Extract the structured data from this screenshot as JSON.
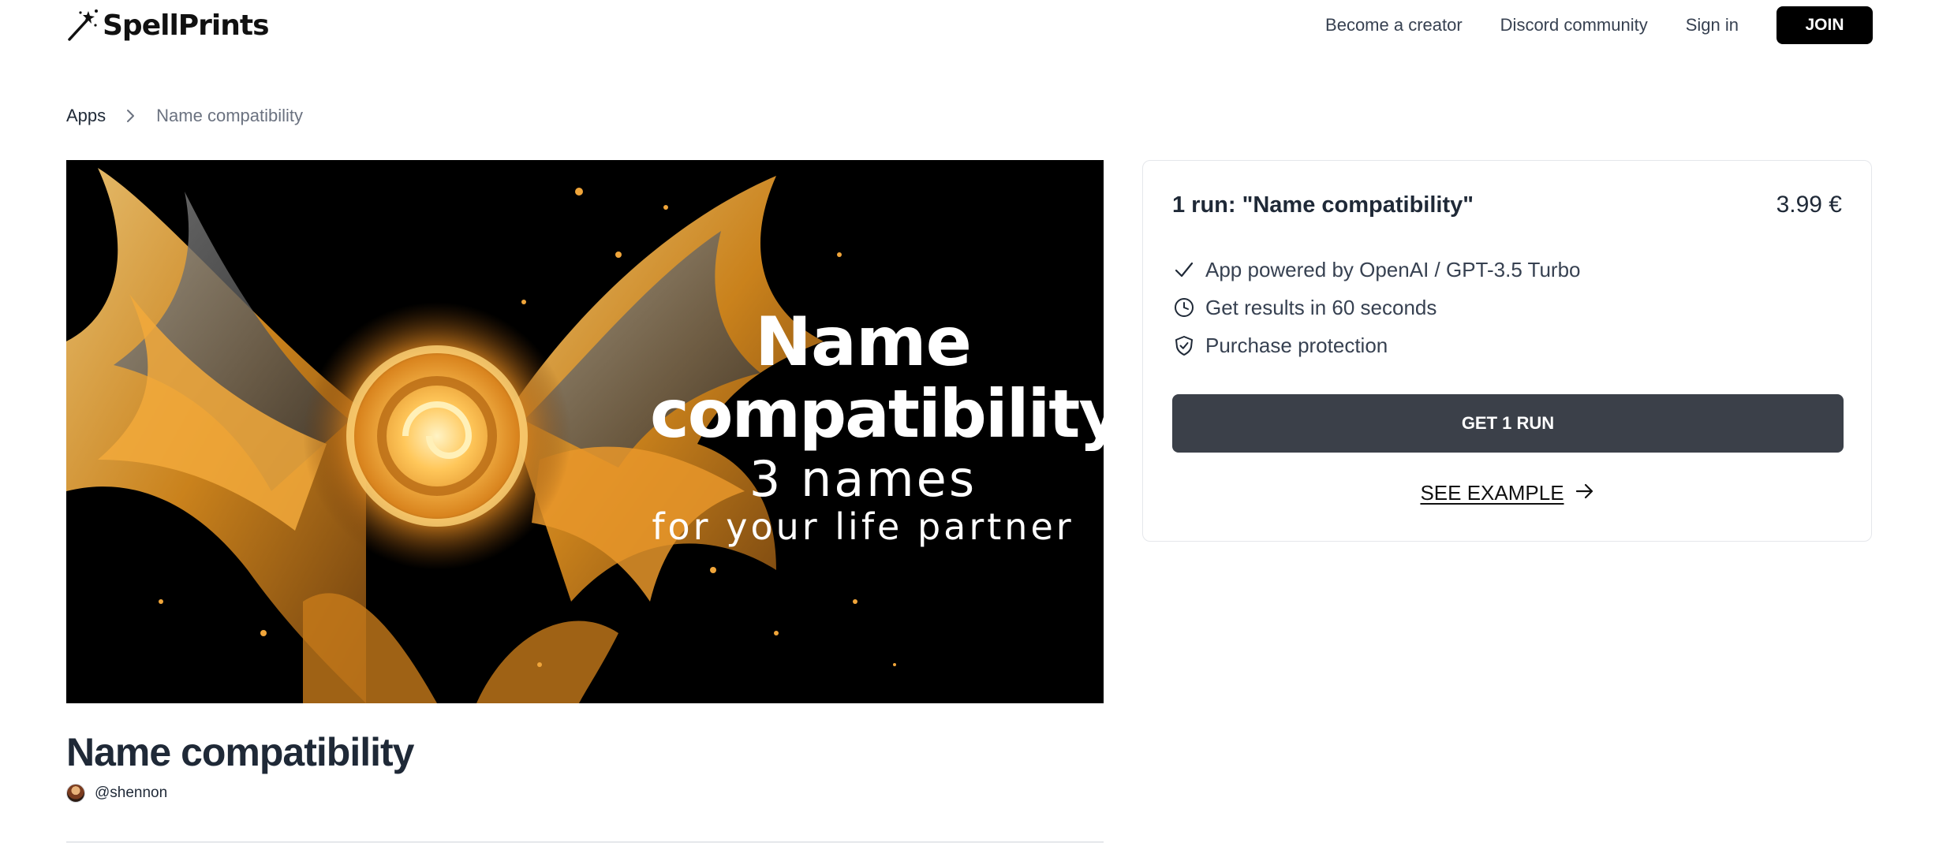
{
  "header": {
    "logo_text": "SpellPrints",
    "nav": {
      "become_creator": "Become a creator",
      "discord": "Discord community",
      "sign_in": "Sign in",
      "join": "JOIN"
    }
  },
  "breadcrumb": {
    "root": "Apps",
    "current": "Name compatibility"
  },
  "hero": {
    "title_line_1": "Name",
    "title_line_2": "compatibility",
    "subtitle_line_1": "3 names",
    "subtitle_line_2": "for your life partner"
  },
  "product": {
    "title": "Name compatibility",
    "author": "@shennon"
  },
  "card": {
    "title": "1 run: \"Name compatibility\"",
    "price": "3.99 €",
    "features": [
      {
        "icon": "check-icon",
        "label": "App powered by OpenAI / GPT-3.5 Turbo"
      },
      {
        "icon": "clock-icon",
        "label": "Get results in 60 seconds"
      },
      {
        "icon": "shield-check-icon",
        "label": "Purchase protection"
      }
    ],
    "buy_label": "GET 1 RUN",
    "example_label": "SEE EXAMPLE"
  },
  "colors": {
    "primary_button": "#3b4049",
    "join_button": "#000000",
    "hero_gold": "#e89a2c",
    "text_dark": "#1f2937",
    "text_muted": "#6b7280"
  }
}
